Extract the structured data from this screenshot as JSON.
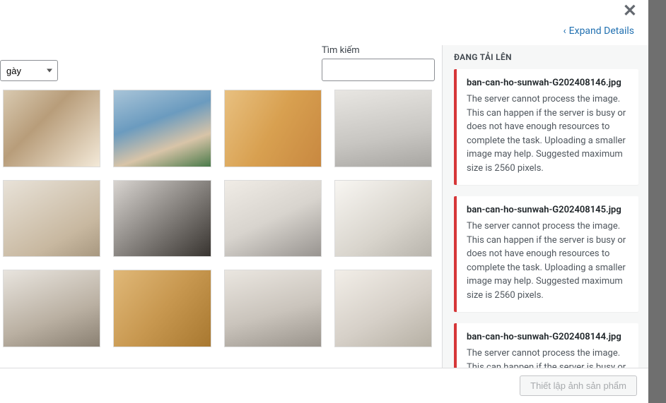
{
  "header": {
    "expand_label": "Expand Details",
    "close_aria": "Close"
  },
  "filters": {
    "date_selected": "gày",
    "search_label": "Tìm kiếm",
    "search_value": ""
  },
  "sidebar": {
    "title": "ĐANG TẢI LÊN",
    "uploads": [
      {
        "filename": "ban-can-ho-sunwah-G202408146.jpg",
        "error": "The server cannot process the image. This can happen if the server is busy or does not have enough resources to complete the task. Uploading a smaller image may help. Suggested maximum size is 2560 pixels."
      },
      {
        "filename": "ban-can-ho-sunwah-G202408145.jpg",
        "error": "The server cannot process the image. This can happen if the server is busy or does not have enough resources to complete the task. Uploading a smaller image may help. Suggested maximum size is 2560 pixels."
      },
      {
        "filename": "ban-can-ho-sunwah-G202408144.jpg",
        "error": "The server cannot process the image. This can happen if the server is busy or does"
      }
    ]
  },
  "footer": {
    "primary_label": "Thiết lập ảnh sản phẩm"
  }
}
